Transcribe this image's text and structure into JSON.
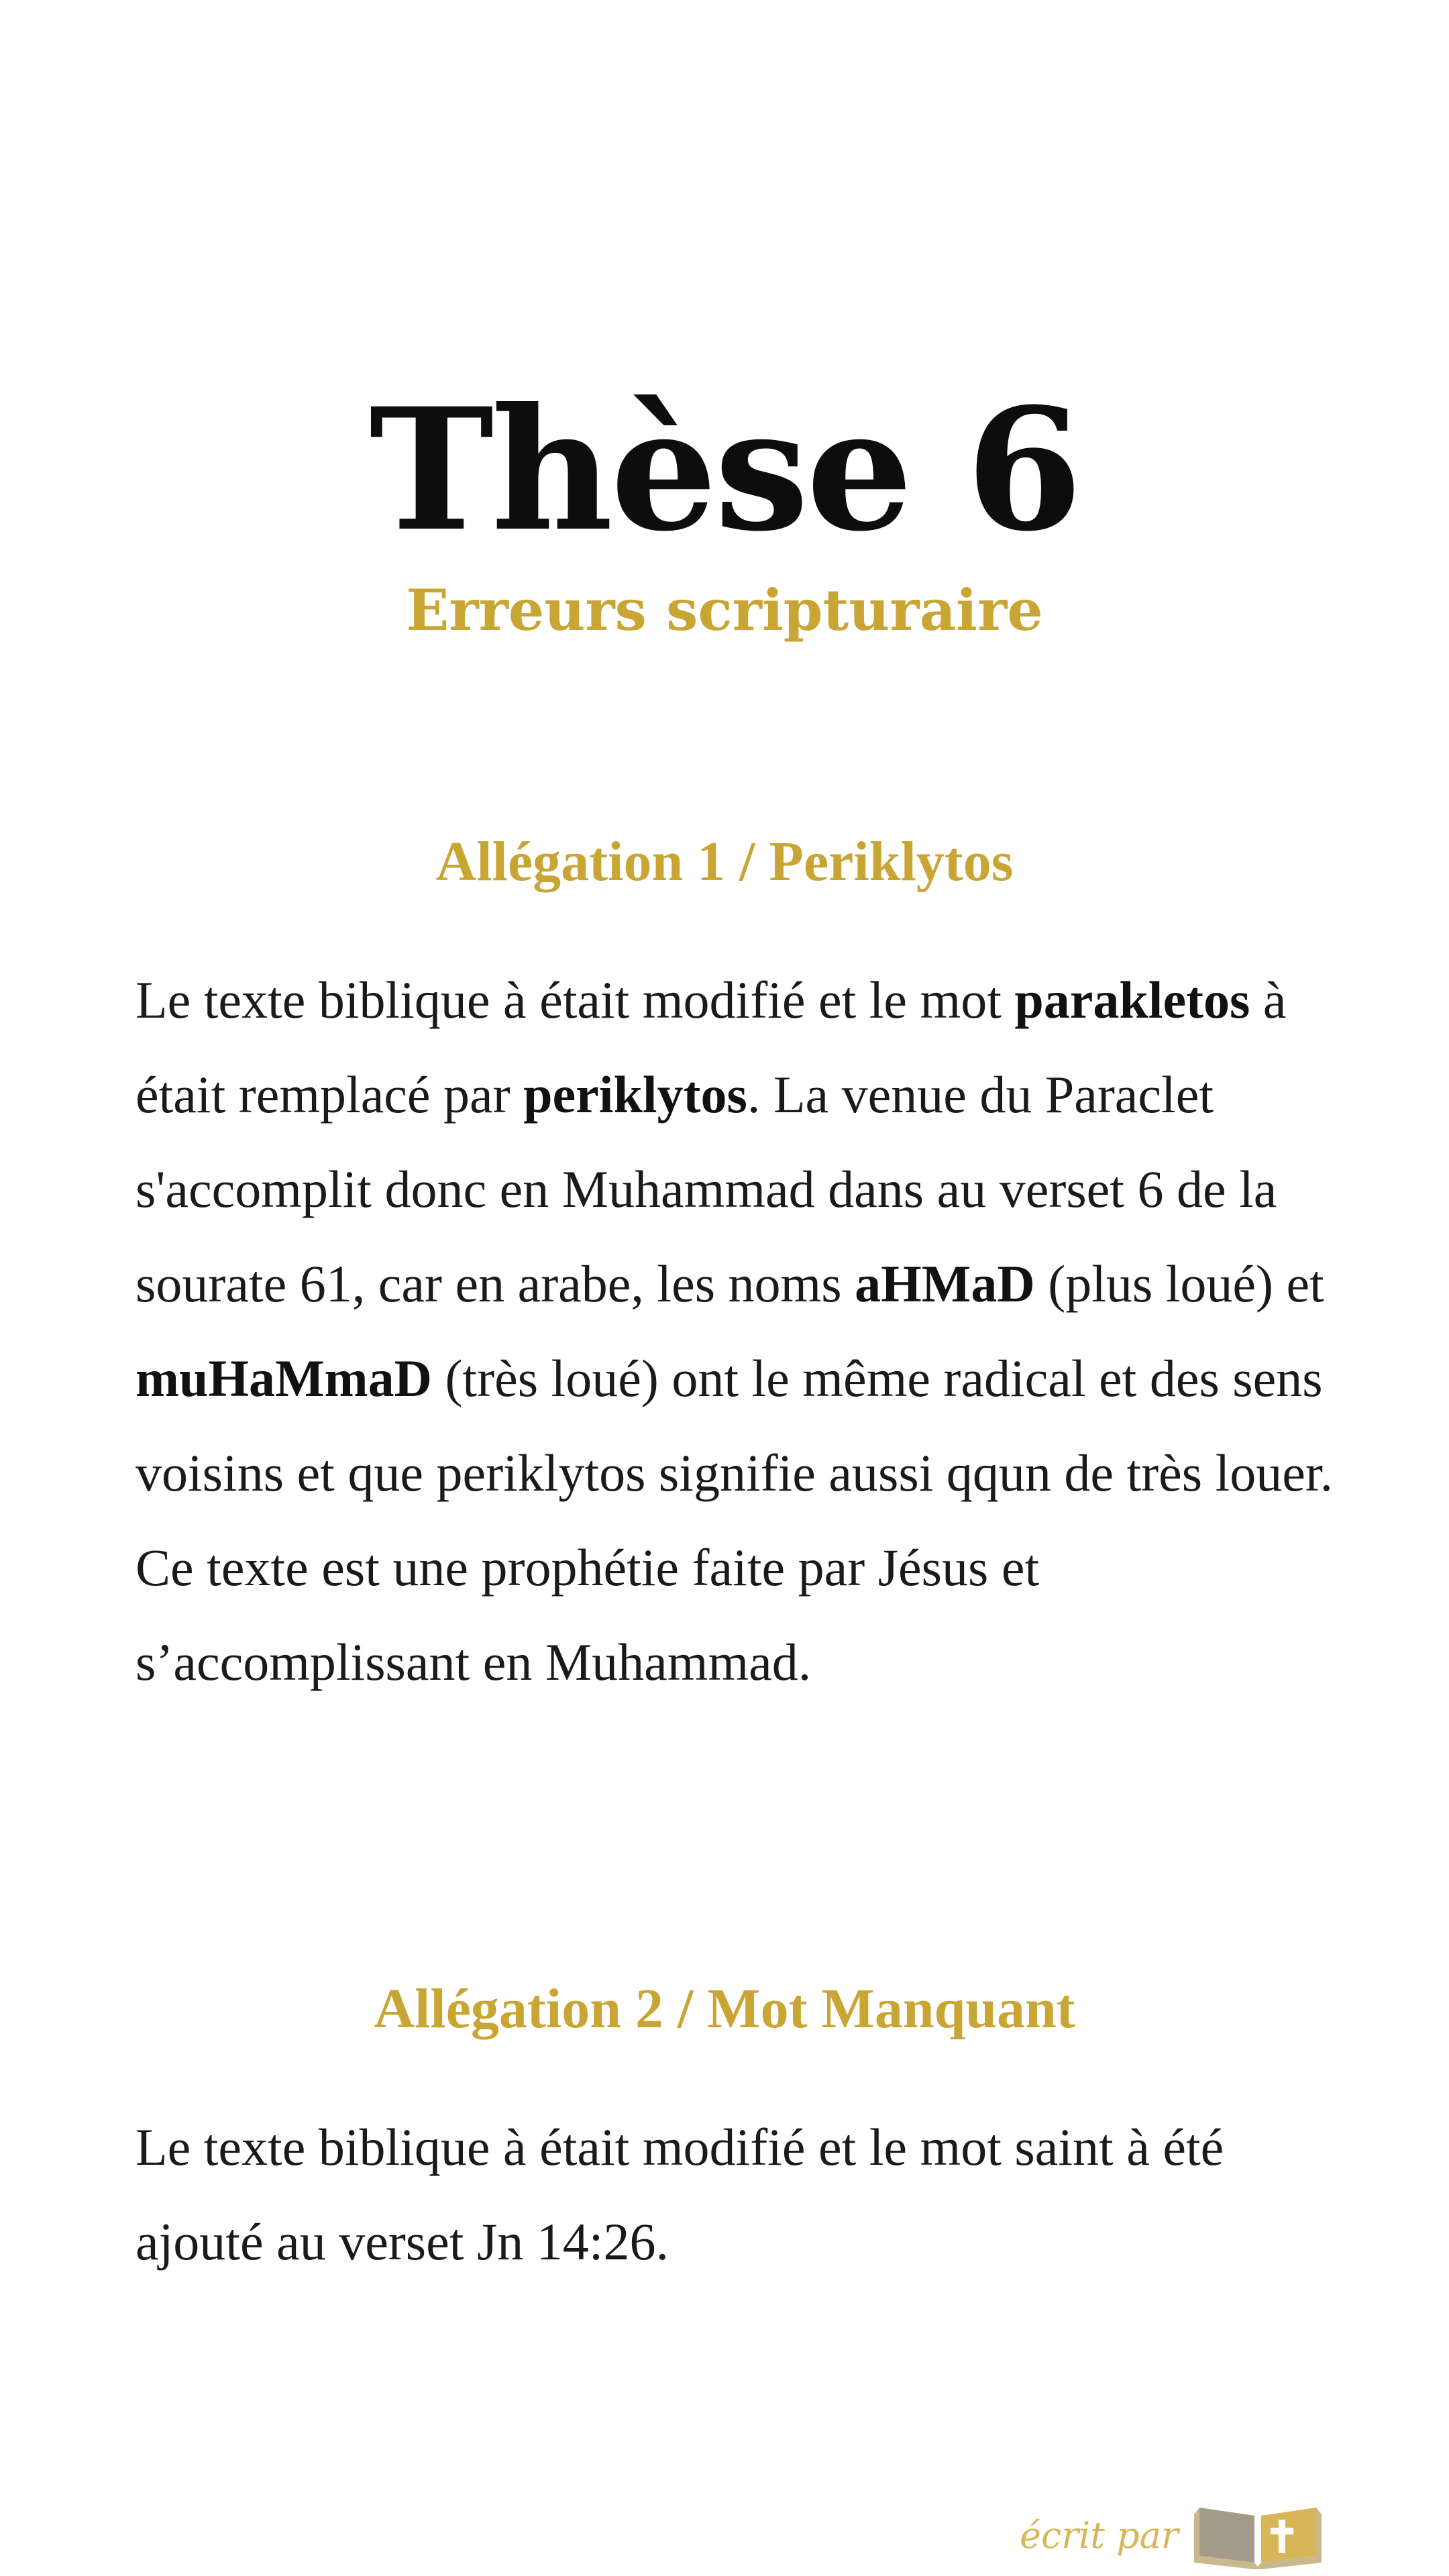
{
  "header": {
    "title": "Thèse 6",
    "subtitle": "Erreurs scripturaire"
  },
  "sections": [
    {
      "heading": "Allégation 1 / Periklytos",
      "paragraph": {
        "p01": "Le texte biblique à était modifié et le mot ",
        "b01": "parakletos",
        "p02": " à était remplacé par ",
        "b02": "periklytos",
        "p03": ". La venue du Paraclet s'accomplit donc  en Muhammad dans au verset 6 de la sourate 61, car en arabe, les noms ",
        "b03": "aHMaD",
        "p04": " (plus loué) et ",
        "b04": "muHaMmaD",
        "p05": " (très loué) ont le même radical et des sens voisins et que periklytos signifie aussi qqun de très louer. Ce texte est une prophétie faite par Jésus et s’accomplissant en Muhammad."
      }
    },
    {
      "heading": "Allégation 2 / Mot Manquant",
      "paragraph": {
        "p01": "Le texte biblique à était modifié et le mot saint à été ajouté au verset Jn 14:26."
      }
    }
  ],
  "footer": {
    "signature": "écrit par",
    "logo_icon": "open-book-cross-icon"
  },
  "colors": {
    "accent_gold": "#c9a534",
    "text": "#1a1a1a",
    "background": "#ffffff"
  }
}
